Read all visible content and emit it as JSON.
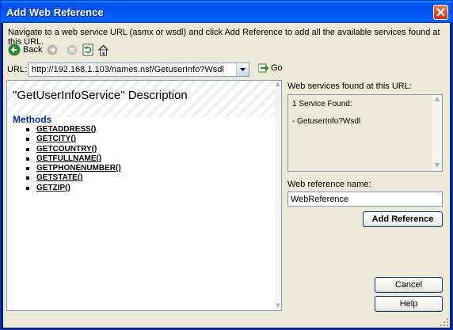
{
  "window": {
    "title": "Add Web Reference"
  },
  "instruction": "Navigate to a web service URL (asmx or wsdl) and click Add Reference to add all the available services found at this URL.",
  "toolbar": {
    "back_label": "Back",
    "icons": [
      "back-arrow-icon",
      "forward-arrow-icon",
      "stop-icon",
      "refresh-icon",
      "home-icon"
    ]
  },
  "url": {
    "label": "URL:",
    "value": "http://192.168.1.103/names.nsf/GetuserInfo?Wsdl",
    "go_label": "Go"
  },
  "browser": {
    "title": "\"GetUserInfoService\" Description",
    "methods_heading": "Methods",
    "methods": [
      "GETADDRESS()",
      "GETCITY()",
      "GETCOUNTRY()",
      "GETFULLNAME()",
      "GETPHONENUMBER()",
      "GETSTATE()",
      "GETZIP()"
    ]
  },
  "services": {
    "label": "Web services found at this URL:",
    "count_text": "1 Service Found:",
    "items": [
      "- GetuserInfo?Wsdl"
    ]
  },
  "reference": {
    "label": "Web reference name:",
    "value": "WebReference"
  },
  "buttons": {
    "add_reference": "Add Reference",
    "cancel": "Cancel",
    "help": "Help"
  },
  "colors": {
    "titlebar": "#0054e3",
    "dialog_bg": "#ece9d8",
    "methods_heading": "#003399",
    "input_border": "#7f9db9"
  }
}
